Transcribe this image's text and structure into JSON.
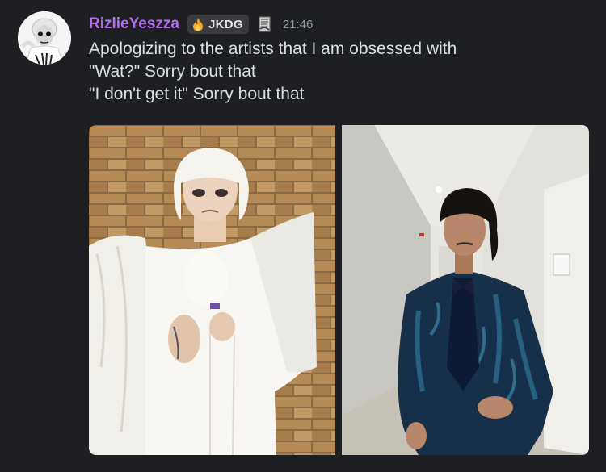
{
  "message": {
    "author": {
      "name": "RizlieYeszza",
      "avatar_icon": "avatar-portrait",
      "name_color": "#b56cf2"
    },
    "clan_tag": {
      "icon": "flame-icon",
      "label": "JKDG"
    },
    "badge_icon": "scroll-badge-icon",
    "timestamp": "21:46",
    "lines": [
      "Apologizing to the artists that I am obsessed with",
      "\"Wat?\" Sorry bout that",
      "\"I don't get it\" Sorry bout that"
    ],
    "attachments": [
      {
        "icon": "photo-person-white-outfit-brick-wall"
      },
      {
        "icon": "photo-person-blue-suit-hallway"
      }
    ]
  }
}
